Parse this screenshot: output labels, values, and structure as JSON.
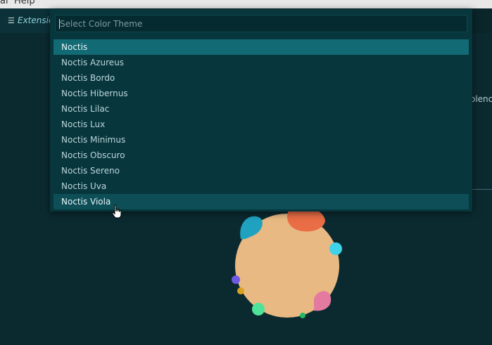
{
  "menubar": {
    "items": [
      "al",
      "Help"
    ]
  },
  "tab": {
    "label": "Extensio"
  },
  "background": {
    "right_text": "olenc"
  },
  "quick_pick": {
    "placeholder": "Select Color Theme",
    "items": [
      "Noctis",
      "Noctis Azureus",
      "Noctis Bordo",
      "Noctis Hibernus",
      "Noctis Lilac",
      "Noctis Lux",
      "Noctis Minimus",
      "Noctis Obscuro",
      "Noctis Sereno",
      "Noctis Uva",
      "Noctis Viola"
    ],
    "selected_index": 0,
    "hovered_index": 10
  },
  "colors": {
    "background": "#0b2a30",
    "palette_bg": "#07363d",
    "selected": "#126a74",
    "hover": "#0d4e57",
    "logo_body": "#e8b983"
  },
  "icons": [
    "menu-icon",
    "hand-pointer-icon",
    "noctis-logo"
  ]
}
